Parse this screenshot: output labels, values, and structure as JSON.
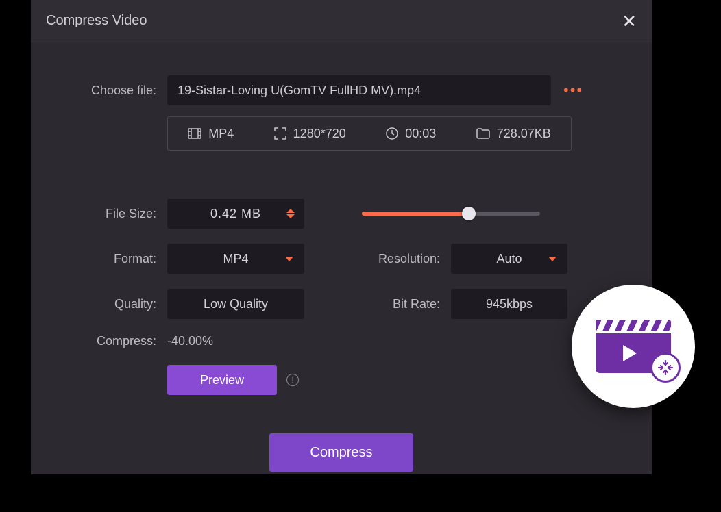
{
  "window": {
    "title": "Compress Video"
  },
  "file": {
    "choose_label": "Choose file:",
    "name": "19-Sistar-Loving U(GomTV FullHD MV).mp4"
  },
  "meta": {
    "format": "MP4",
    "resolution": "1280*720",
    "duration": "00:03",
    "size": "728.07KB"
  },
  "form": {
    "file_size_label": "File Size:",
    "file_size_value": "0.42  MB",
    "format_label": "Format:",
    "format_value": "MP4",
    "quality_label": "Quality:",
    "quality_value": "Low Quality",
    "resolution_label": "Resolution:",
    "resolution_value": "Auto",
    "bitrate_label": "Bit Rate:",
    "bitrate_value": "945kbps",
    "compress_label": "Compress:",
    "compress_value": "-40.00%",
    "slider_percent": 60
  },
  "buttons": {
    "preview": "Preview",
    "compress": "Compress"
  },
  "colors": {
    "accent_orange": "#ff6a3d",
    "accent_purple": "#8a4bd4",
    "badge_purple": "#6f2fa4"
  }
}
